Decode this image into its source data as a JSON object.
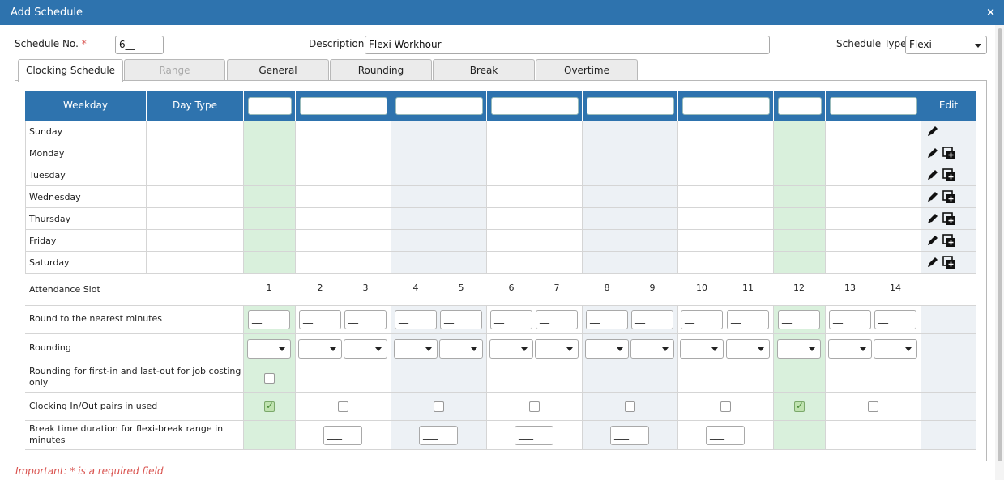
{
  "title": "Add Schedule",
  "close_glyph": "×",
  "form": {
    "schedule_no_label": "Schedule No.",
    "required_mark": "*",
    "schedule_no_value": "6__",
    "description_label": "Description",
    "description_value": "Flexi Workhour",
    "schedule_type_label": "Schedule Type",
    "schedule_type_value": "Flexi"
  },
  "tabs": [
    {
      "label": "Clocking Schedule",
      "state": "active"
    },
    {
      "label": "Range",
      "state": "disabled"
    },
    {
      "label": "General",
      "state": "normal"
    },
    {
      "label": "Rounding",
      "state": "normal"
    },
    {
      "label": "Break",
      "state": "normal"
    },
    {
      "label": "Overtime",
      "state": "normal"
    }
  ],
  "table": {
    "weekday_header": "Weekday",
    "daytype_header": "Day Type",
    "edit_header": "Edit",
    "days": [
      "Sunday",
      "Monday",
      "Tuesday",
      "Wednesday",
      "Thursday",
      "Friday",
      "Saturday"
    ]
  },
  "slots": {
    "label": "Attendance Slot",
    "numbers": [
      "1",
      "2",
      "3",
      "4",
      "5",
      "6",
      "7",
      "8",
      "9",
      "10",
      "11",
      "12",
      "13",
      "14"
    ]
  },
  "rows": {
    "round_nearest": "Round to the nearest minutes",
    "rounding": "Rounding",
    "first_in_last_out": "Rounding for first-in and last-out for job costing only",
    "pairs_used": "Clocking In/Out pairs in used",
    "break_duration": "Break time duration for flexi-break range in minutes"
  },
  "placeholder_short": "__",
  "placeholder_long": "___",
  "colors": {
    "accent": "#2e73ae",
    "green_col": "#d9f0dc",
    "gray_col": "#edf1f5",
    "required": "#d9534f"
  },
  "icons": {
    "edit": "pencil-icon",
    "copy": "copy-add-icon"
  },
  "footer_note": "Important: * is a required field"
}
